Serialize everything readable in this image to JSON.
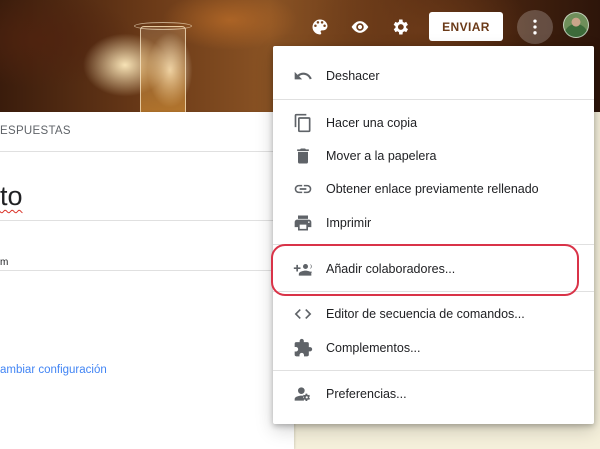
{
  "header": {
    "send_label": "ENVIAR",
    "icons": [
      "palette-icon",
      "eye-icon",
      "gear-icon",
      "more-vert-icon"
    ],
    "accent_color": "#6b3a18"
  },
  "form": {
    "tab_responses": "ESPUESTAS",
    "title_fragment": "to",
    "desc_fragment": "m",
    "config_link": "ambiar configuración",
    "link_color": "#4285f4"
  },
  "menu": {
    "items": [
      {
        "label": "Deshacer",
        "icon": "undo-icon"
      },
      {
        "label": "Hacer una copia",
        "icon": "copy-icon"
      },
      {
        "label": "Mover a la papelera",
        "icon": "trash-icon"
      },
      {
        "label": "Obtener enlace previamente rellenado",
        "icon": "link-icon"
      },
      {
        "label": "Imprimir",
        "icon": "print-icon"
      },
      {
        "label": "Añadir colaboradores...",
        "icon": "add-people-icon"
      },
      {
        "label": "Editor de secuencia de comandos...",
        "icon": "code-icon"
      },
      {
        "label": "Complementos...",
        "icon": "puzzle-icon"
      },
      {
        "label": "Preferencias...",
        "icon": "person-settings-icon"
      }
    ],
    "highlight_color": "#d93348"
  }
}
